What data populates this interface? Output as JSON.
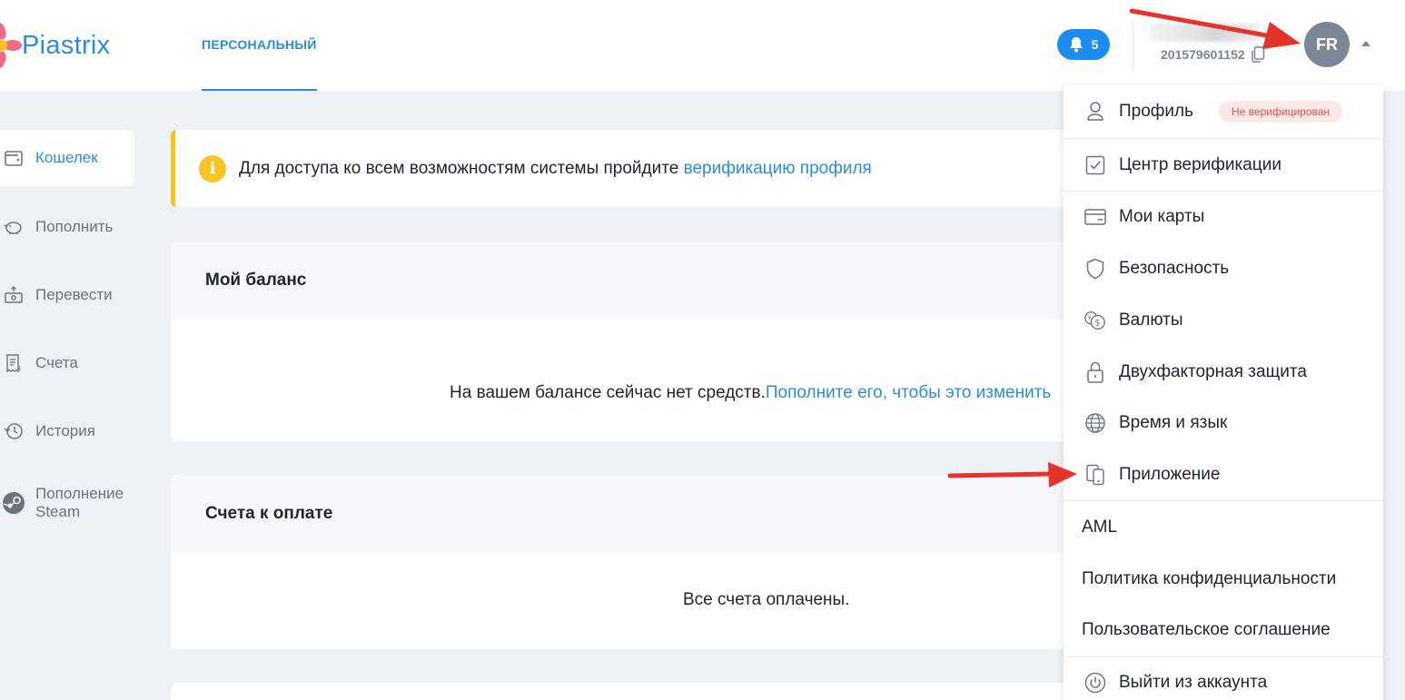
{
  "header": {
    "logo_text": "Piastrix",
    "nav_tab": "ПЕРСОНАЛЬНЫЙ",
    "notifications_count": "5",
    "account_id": "201579601152",
    "avatar_initials": "FR"
  },
  "sidebar": {
    "items": [
      {
        "label": "Кошелек",
        "icon": "wallet-icon",
        "active": true
      },
      {
        "label": "Пополнить",
        "icon": "piggy-bank-icon"
      },
      {
        "label": "Перевести",
        "icon": "money-transfer-icon"
      },
      {
        "label": "Счета",
        "icon": "invoice-icon"
      },
      {
        "label": "История",
        "icon": "history-icon"
      },
      {
        "label_line1": "Пополнение",
        "label_line2": "Steam",
        "icon": "steam-icon"
      }
    ]
  },
  "alert": {
    "text": "Для доступа ко всем возможностям системы пройдите ",
    "link": "верификацию профиля"
  },
  "balance_card": {
    "title": "Мой баланс",
    "text": "На вашем балансе сейчас нет средств. ",
    "link": "Пополните его, чтобы это изменить"
  },
  "invoices_card": {
    "title": "Счета к оплате",
    "text": "Все счета оплачены."
  },
  "dropdown": {
    "profile": "Профиль",
    "profile_badge": "Не верифицирован",
    "verification_center": "Центр верификации",
    "my_cards": "Мои карты",
    "security": "Безопасность",
    "currencies": "Валюты",
    "two_factor": "Двухфакторная защита",
    "time_language": "Время и язык",
    "app": "Приложение",
    "aml": "AML",
    "privacy_policy": "Политика конфиденциальности",
    "user_agreement": "Пользовательское соглашение",
    "logout": "Выйти из аккаунта"
  },
  "colors": {
    "accent": "#2b8be0",
    "notification_bg": "#1d8cf0",
    "alert_yellow": "#f7c41a",
    "avatar_bg": "#7d8694",
    "annotation_arrow": "#e5322b"
  }
}
